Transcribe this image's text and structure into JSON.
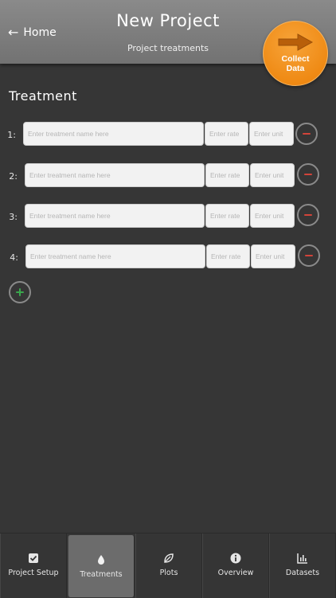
{
  "header": {
    "back_label": "Home",
    "title": "New Project",
    "subtitle": "Project treatments",
    "collect_button": {
      "line1": "Collect",
      "line2": "Data",
      "color": "#ef8a14"
    }
  },
  "section_title": "Treatment",
  "treatments": [
    {
      "number": "1:",
      "name_placeholder": "Enter treatment name here",
      "rate_placeholder": "Enter rate",
      "unit_placeholder": "Enter unit"
    },
    {
      "number": "2:",
      "name_placeholder": "Enter treatment name here",
      "rate_placeholder": "Enter rate",
      "unit_placeholder": "Enter unit"
    },
    {
      "number": "3:",
      "name_placeholder": "Enter treatment name here",
      "rate_placeholder": "Enter rate",
      "unit_placeholder": "Enter unit"
    },
    {
      "number": "4:",
      "name_placeholder": "Enter treatment name here",
      "rate_placeholder": "Enter rate",
      "unit_placeholder": "Enter unit"
    }
  ],
  "icons": {
    "back": "arrow-left-icon",
    "collect": "arrow-right-icon",
    "remove": "minus-circle-icon",
    "add": "plus-circle-icon"
  },
  "colors": {
    "remove_accent": "#d2443a",
    "add_accent": "#3aa84d"
  },
  "tabs": [
    {
      "label": "Project Setup",
      "icon": "checkbox-icon",
      "active": false
    },
    {
      "label": "Treatments",
      "icon": "droplet-icon",
      "active": true
    },
    {
      "label": "Plots",
      "icon": "leaf-icon",
      "active": false
    },
    {
      "label": "Overview",
      "icon": "info-icon",
      "active": false
    },
    {
      "label": "Datasets",
      "icon": "bar-chart-icon",
      "active": false
    }
  ]
}
